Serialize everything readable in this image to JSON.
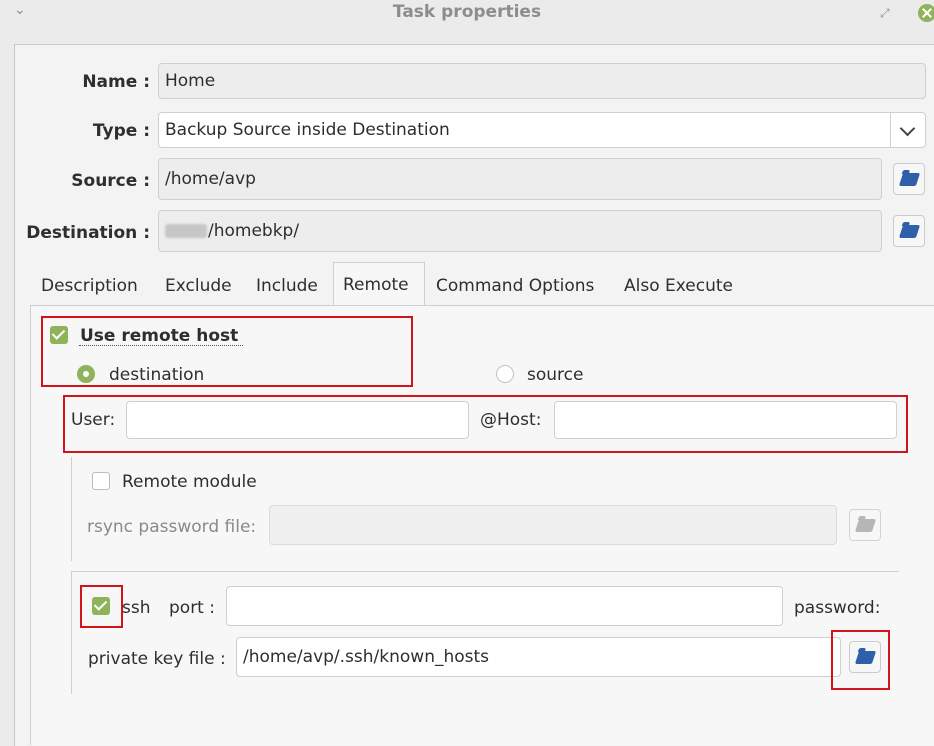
{
  "window": {
    "title": "Task properties"
  },
  "form": {
    "name_label": "Name :",
    "name_value": "Home",
    "type_label": "Type :",
    "type_value": "Backup Source inside Destination",
    "source_label": "Source :",
    "source_value": "/home/avp",
    "destination_label": "Destination :",
    "destination_value": "/homebkp/"
  },
  "tabs": [
    {
      "label": "Description"
    },
    {
      "label": "Exclude"
    },
    {
      "label": "Include"
    },
    {
      "label": "Remote",
      "active": true
    },
    {
      "label": "Command Options"
    },
    {
      "label": "Also Execute"
    }
  ],
  "remote": {
    "use_remote_host_label": "Use remote host",
    "use_remote_host_checked": true,
    "destination_label": "destination",
    "destination_selected": true,
    "source_label": "source",
    "source_selected": false,
    "user_label": "User:",
    "user_value": "",
    "host_label": "@Host:",
    "host_value": "",
    "remote_module_label": "Remote module",
    "remote_module_checked": false,
    "rsync_password_label": "rsync password file:",
    "rsync_password_value": "",
    "ssh_label": "ssh",
    "ssh_checked": true,
    "port_label": "port :",
    "port_value": "",
    "password_label": "password:",
    "private_key_label": "private key file :",
    "private_key_value": "/home/avp/.ssh/known_hosts"
  },
  "colors": {
    "accent": "#8fb35a",
    "highlight": "#d0141a",
    "folder_icon": "#2f5fa8"
  },
  "icons": [
    "chevron-down-icon",
    "maximize-icon",
    "close-icon",
    "folder-icon",
    "checkbox-icon",
    "radio-icon"
  ]
}
